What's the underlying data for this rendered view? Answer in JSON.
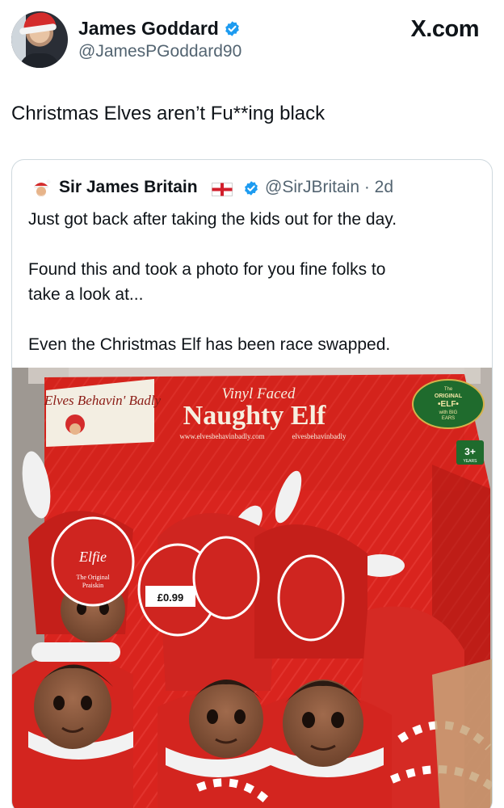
{
  "header": {
    "display_name": "James Goddard",
    "handle": "@JamesPGoddard90",
    "site_logo": "X.com",
    "verified_icon": "verified-badge-icon"
  },
  "tweet": {
    "text": "Christmas Elves aren’t Fu**ing black"
  },
  "quoted_tweet": {
    "display_name": "Sir James Britain",
    "flag_icon": "england-flag-icon",
    "handle_and_time": "@SirJBritain · 2d",
    "lines": [
      "Just got back after taking the kids out for the day.",
      "",
      "Found this and took a photo for you fine folks to",
      "take a look at...",
      "",
      "Even the Christmas Elf has been race swapped."
    ],
    "photo": {
      "box_brand": "Elves Behavin' Badly",
      "box_subtitle": "Vinyl Faced",
      "box_title": "Naughty Elf",
      "box_url": "www.elvesbehavinbadly.com",
      "box_social": "elvesbehavinbadly",
      "seal_text": [
        "The",
        "ORIGINAL",
        "•ELF•",
        "with BIG",
        "EARS"
      ],
      "age_badge": [
        "3+",
        "YEARS"
      ],
      "tag_name": "Elfie",
      "tag_subtitle": [
        "The Original",
        "Praiskin"
      ],
      "price": "£0.99"
    }
  },
  "colors": {
    "text_primary": "#0f1419",
    "text_secondary": "#536471",
    "verified_blue": "#1d9bf0",
    "border": "#cfd9de",
    "box_red": "#d9241e"
  }
}
